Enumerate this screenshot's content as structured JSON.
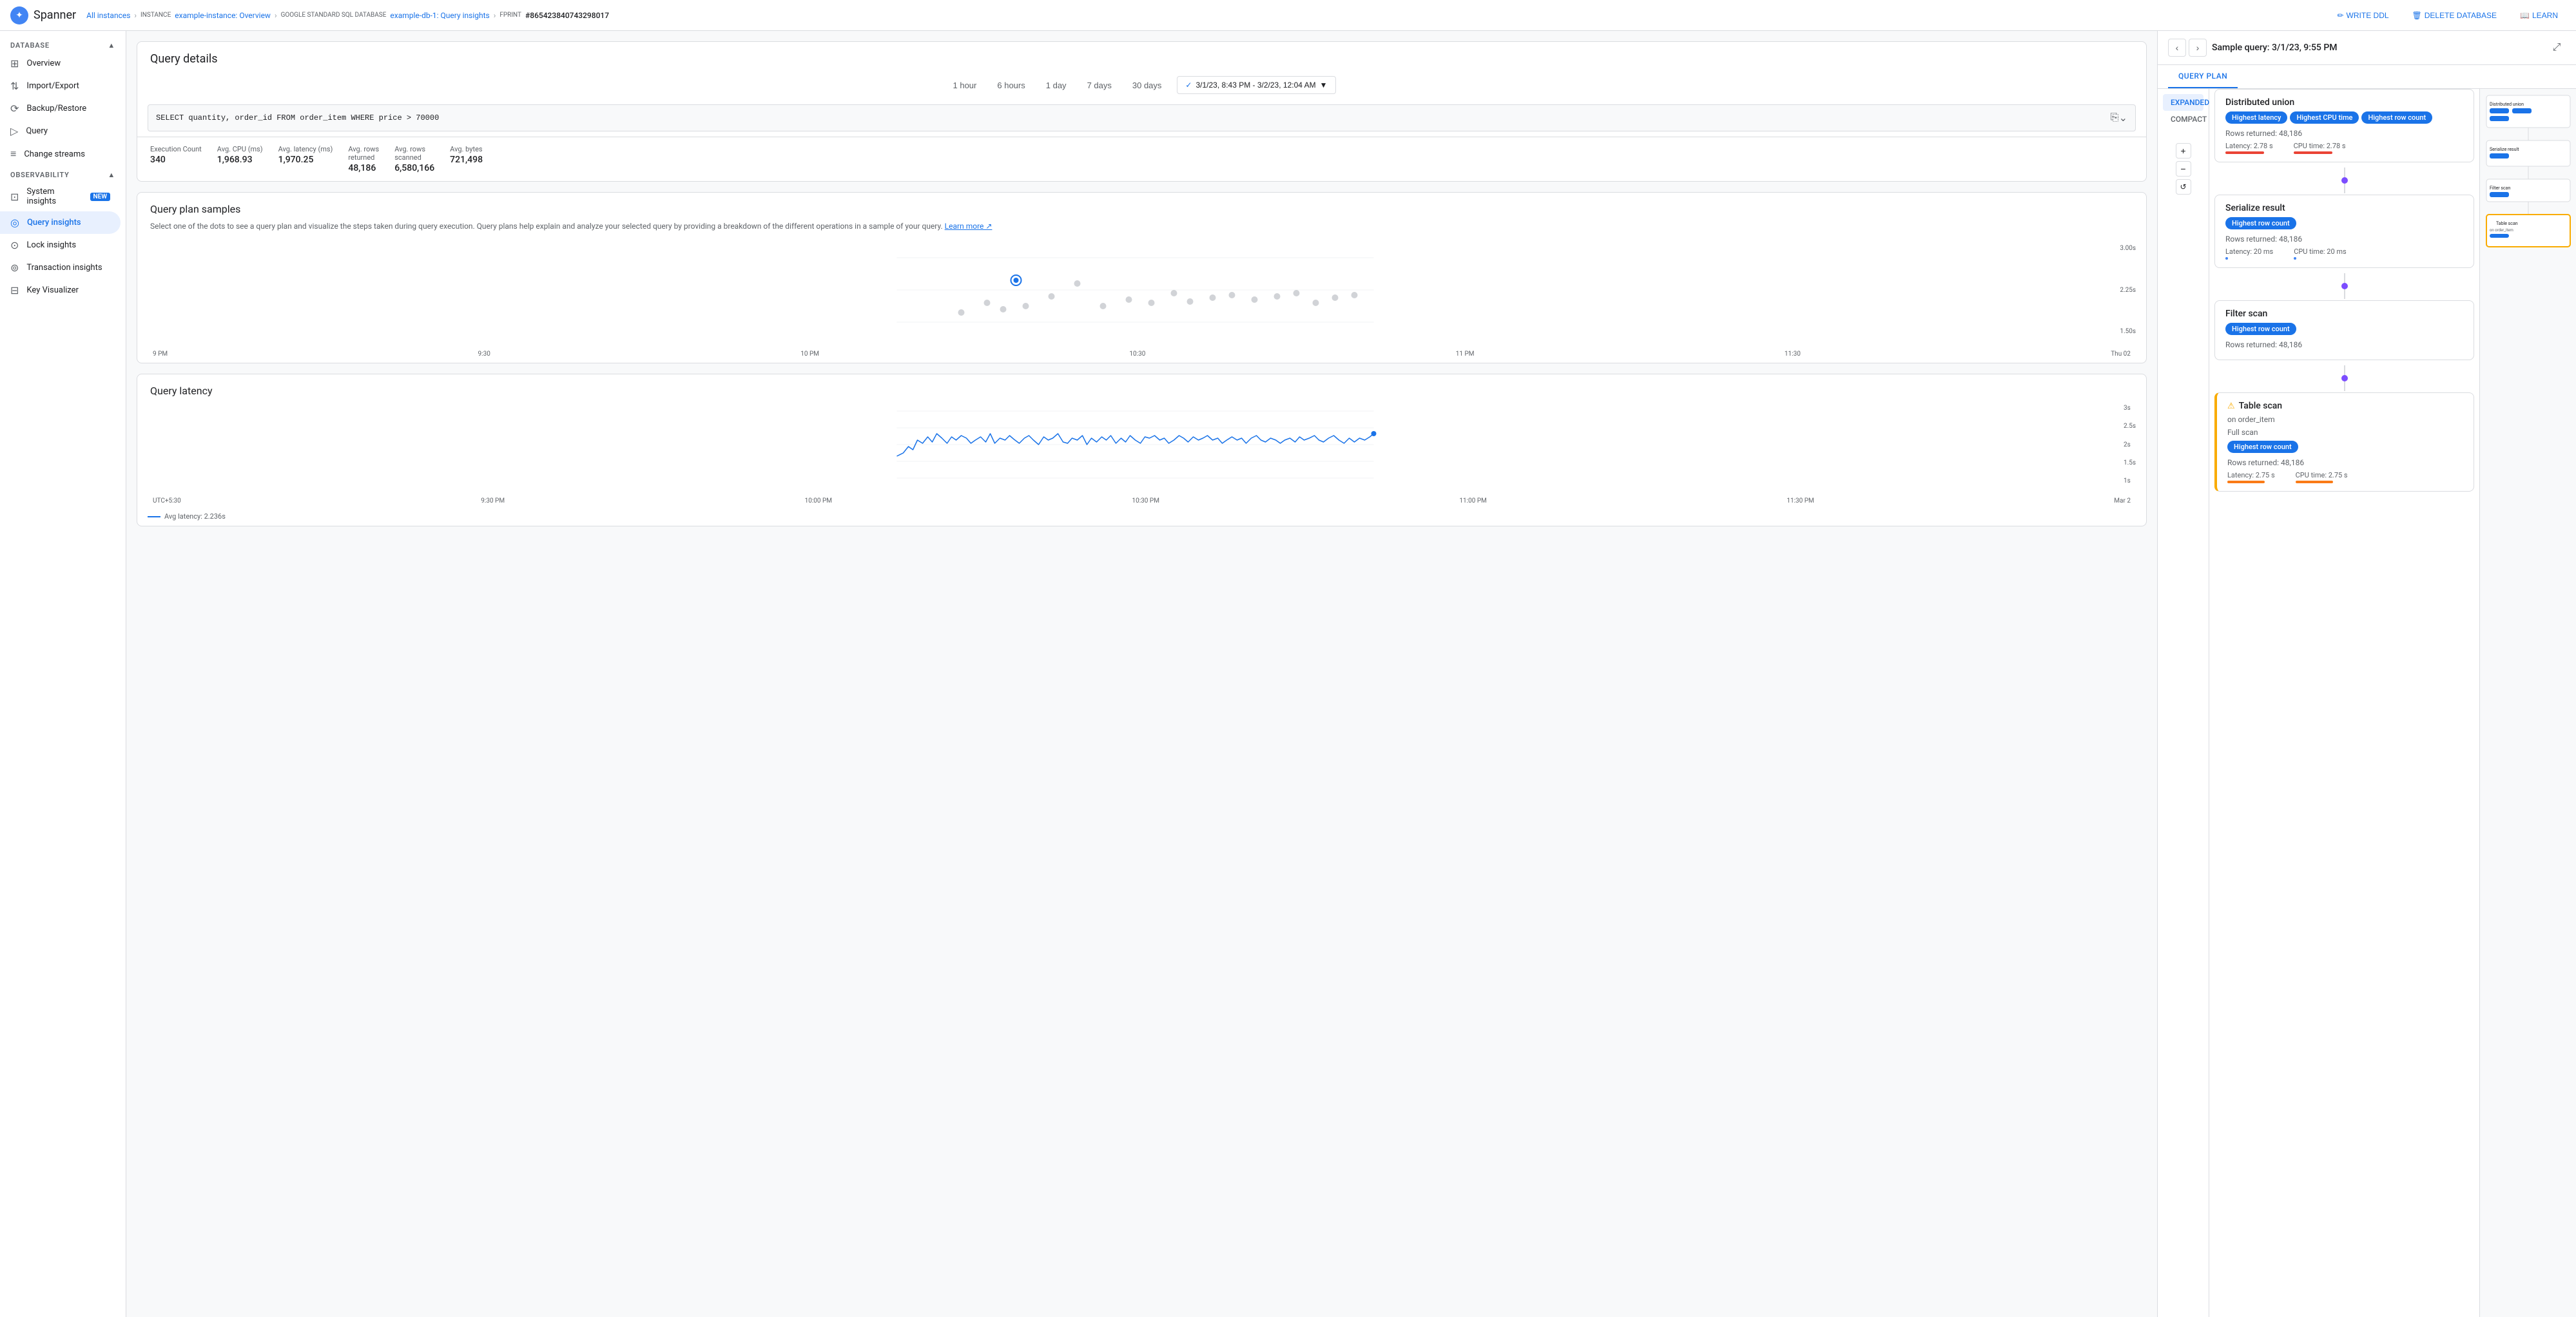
{
  "app": {
    "name": "Spanner"
  },
  "breadcrumb": {
    "all_instances": "All instances",
    "instance_label": "INSTANCE",
    "instance_name": "example-instance: Overview",
    "database_label": "GOOGLE STANDARD SQL DATABASE",
    "database_name": "example-db-1: Query insights",
    "fprint_label": "FPRINT",
    "fprint_value": "#865423840743298017"
  },
  "top_actions": {
    "write_ddl": "WRITE DDL",
    "delete_database": "DELETE DATABASE",
    "learn": "LEARN"
  },
  "sidebar": {
    "database_section": "DATABASE",
    "observability_section": "OBSERVABILITY",
    "db_items": [
      {
        "id": "overview",
        "label": "Overview",
        "icon": "⊞"
      },
      {
        "id": "import-export",
        "label": "Import/Export",
        "icon": "⇅"
      },
      {
        "id": "backup-restore",
        "label": "Backup/Restore",
        "icon": "⟳"
      },
      {
        "id": "query",
        "label": "Query",
        "icon": "▷"
      },
      {
        "id": "change-streams",
        "label": "Change streams",
        "icon": "≡"
      }
    ],
    "obs_items": [
      {
        "id": "system-insights",
        "label": "System insights",
        "icon": "⊡",
        "badge": "NEW"
      },
      {
        "id": "query-insights",
        "label": "Query insights",
        "icon": "◎",
        "active": true
      },
      {
        "id": "lock-insights",
        "label": "Lock insights",
        "icon": "⊙"
      },
      {
        "id": "transaction-insights",
        "label": "Transaction insights",
        "icon": "⊚"
      },
      {
        "id": "key-visualizer",
        "label": "Key Visualizer",
        "icon": "⊟"
      }
    ]
  },
  "query_details": {
    "title": "Query details",
    "time_options": [
      "1 hour",
      "6 hours",
      "1 day",
      "7 days",
      "30 days"
    ],
    "time_range": "3/1/23, 8:43 PM - 3/2/23, 12:04 AM",
    "query_text": "SELECT quantity, order_id FROM order_item WHERE price > 70000",
    "stats": [
      {
        "label": "Execution Count",
        "value": "340"
      },
      {
        "label": "Avg. CPU (ms)",
        "value": "1,968.93"
      },
      {
        "label": "Avg. latency (ms)",
        "value": "1,970.25"
      },
      {
        "label": "Avg. rows returned",
        "value": "48,186"
      },
      {
        "label": "Avg. rows scanned",
        "value": "6,580,166"
      },
      {
        "label": "Avg. bytes",
        "value": "721,498"
      }
    ]
  },
  "query_plan_samples": {
    "title": "Query plan samples",
    "description": "Select one of the dots to see a query plan and visualize the steps taken during query execution. Query plans help explain and analyze your selected query by providing a breakdown of the different operations in a sample of your query.",
    "learn_more": "Learn more",
    "y_labels": [
      "3.00s",
      "2.25s",
      "1.50s"
    ],
    "x_labels": [
      "9 PM",
      "9:30",
      "10 PM",
      "10:30",
      "11 PM",
      "11:30",
      "Thu 02"
    ]
  },
  "query_latency": {
    "title": "Query latency",
    "y_labels": [
      "3s",
      "2.5s",
      "2s",
      "1.5s",
      "1s"
    ],
    "x_labels": [
      "UTC+5:30",
      "9:30 PM",
      "10:00 PM",
      "10:30 PM",
      "11:00 PM",
      "11:30 PM",
      "Mar 2"
    ],
    "legend_label": "Avg latency: 2.236s"
  },
  "right_panel": {
    "title": "Sample query: 3/1/23, 9:55 PM",
    "tabs": [
      "QUERY PLAN"
    ],
    "subtabs": [
      "EXPANDED",
      "COMPACT"
    ],
    "nodes": [
      {
        "id": "distributed-union",
        "title": "Distributed union",
        "badges": [
          "Highest latency",
          "Highest CPU time",
          "Highest row count"
        ],
        "rows_returned": "Rows returned: 48,186",
        "latency": "Latency: 2.78 s",
        "cpu_time": "CPU time: 2.78 s",
        "latency_bar_type": "red",
        "cpu_bar_type": "red"
      },
      {
        "id": "serialize-result",
        "title": "Serialize result",
        "badges": [
          "Highest row count"
        ],
        "rows_returned": "Rows returned: 48,186",
        "latency": "Latency: 20 ms",
        "cpu_time": "CPU time: 20 ms",
        "latency_bar_type": "blue",
        "cpu_bar_type": "blue"
      },
      {
        "id": "filter-scan",
        "title": "Filter scan",
        "badges": [
          "Highest row count"
        ],
        "rows_returned": "Rows returned: 48,186",
        "latency_bar_type": "blue",
        "cpu_bar_type": "blue"
      },
      {
        "id": "table-scan",
        "title": "Table scan",
        "subtitle": "on order_item",
        "fullscan": "Full scan",
        "badges": [
          "Highest row count"
        ],
        "rows_returned": "Rows returned: 48,186",
        "latency": "Latency: 2.75 s",
        "cpu_time": "CPU time: 2.75 s",
        "latency_bar_type": "orange",
        "cpu_bar_type": "orange",
        "is_warning": true
      }
    ]
  }
}
